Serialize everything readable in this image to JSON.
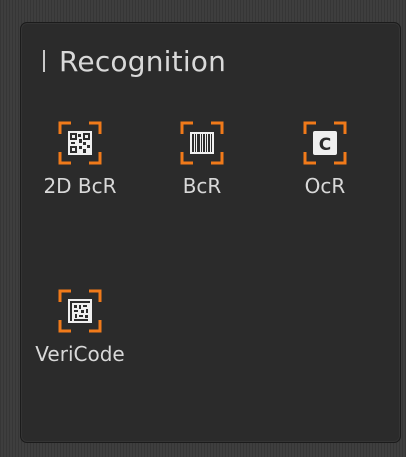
{
  "panel": {
    "title": "Recognition",
    "accent": "#f07a1a",
    "tools": [
      {
        "label": "2D BcR",
        "icon": "qr-code-icon"
      },
      {
        "label": "BcR",
        "icon": "barcode-icon"
      },
      {
        "label": "OcR",
        "icon": "ocr-letter-icon",
        "glyph": "C"
      },
      {
        "label": "VeriCode",
        "icon": "vericode-icon"
      }
    ]
  }
}
